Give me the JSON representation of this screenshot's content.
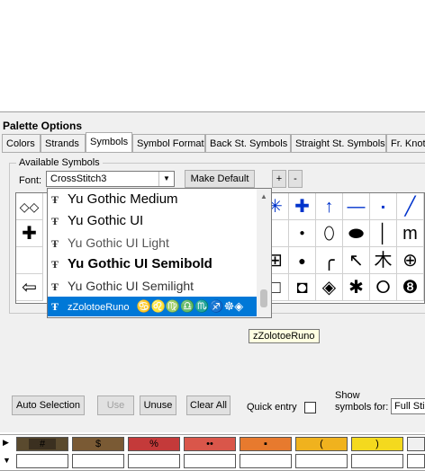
{
  "panel": {
    "title": "Palette Options"
  },
  "tabs": [
    {
      "label": "Colors"
    },
    {
      "label": "Strands"
    },
    {
      "label": "Symbols"
    },
    {
      "label": "Symbol Format"
    },
    {
      "label": "Back St. Symbols"
    },
    {
      "label": "Straight St. Symbols"
    },
    {
      "label": "Fr. Knot"
    }
  ],
  "available_symbols": {
    "group_label": "Available Symbols",
    "font_label": "Font:",
    "font_value": "CrossStitch3",
    "make_default": "Make Default",
    "plus": "+",
    "minus": "-"
  },
  "font_list": [
    {
      "name": "Yu Gothic Medium"
    },
    {
      "name": "Yu Gothic UI"
    },
    {
      "name": "Yu Gothic UI Light"
    },
    {
      "name": "Yu Gothic UI Semibold"
    },
    {
      "name": "Yu Gothic UI Semilight"
    },
    {
      "name": "zZolotoeRuno",
      "preview": "♋♌♍♎♏♐☸◈"
    }
  ],
  "tooltip": "zZolotoeRuno",
  "symbols_col0": [
    "◇◇",
    "✚",
    "",
    "⇦"
  ],
  "symbols_row0": [
    "✳",
    "✚",
    "↑",
    "—",
    "▪",
    "╱"
  ],
  "symbols_row1": [
    "",
    "●",
    "⬯",
    "⬬",
    "│",
    "m"
  ],
  "symbols_row2": [
    "⊞",
    "●",
    "╭",
    "↖",
    "⽊",
    "⊕"
  ],
  "symbols_row3": [
    "□",
    "◘",
    "◈",
    "✱",
    "⭘",
    "❽"
  ],
  "buttons": {
    "auto_selection": "Auto Selection",
    "use": "Use",
    "unuse": "Unuse",
    "clear_all": "Clear All"
  },
  "quick_entry": "Quick entry",
  "show_symbols_for": "Show\nsymbols for:",
  "show_symbols_value": "Full Sti",
  "palette": [
    {
      "symbol": "#",
      "color": "#5a4a2e"
    },
    {
      "symbol": "$",
      "color": "#7a5a34"
    },
    {
      "symbol": "%",
      "color": "#c43a3a"
    },
    {
      "symbol": "••",
      "color": "#d9564a"
    },
    {
      "symbol": "▪",
      "color": "#e77a2e"
    },
    {
      "symbol": "(",
      "color": "#f0b21e"
    },
    {
      "symbol": ")",
      "color": "#f4d91e"
    },
    {
      "symbol": "",
      "color": "#f0f0f0"
    }
  ]
}
